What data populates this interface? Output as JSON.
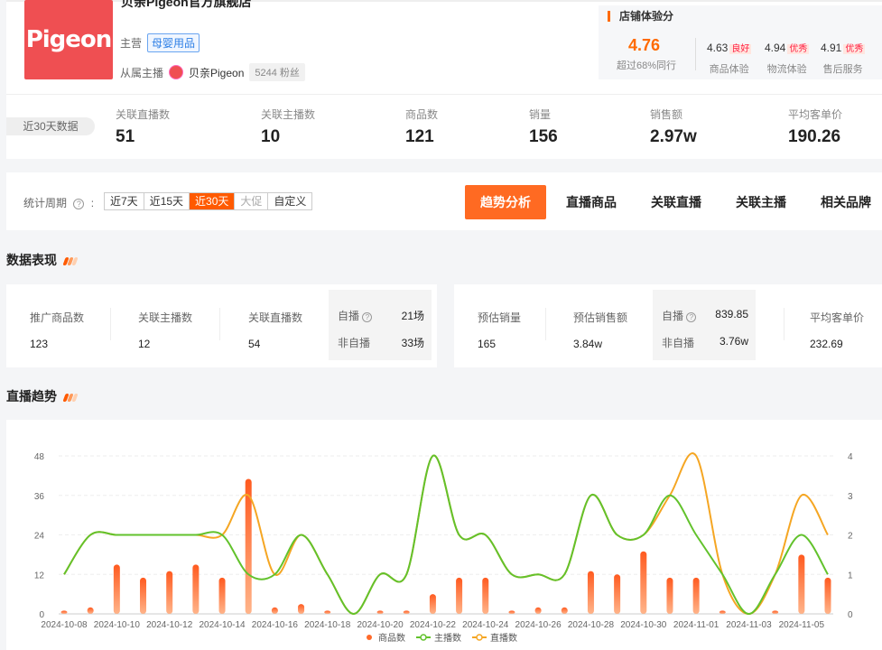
{
  "shop": {
    "logo_text": "Pigeon",
    "name": "贝亲Pigeon官方旗舰店",
    "main_label": "主营",
    "main_category": "母婴用品",
    "anchor_label": "从属主播",
    "anchor_name": "贝亲Pigeon",
    "fans": "5244 粉丝"
  },
  "score": {
    "title": "店铺体验分",
    "overall": "4.76",
    "beyond": "超过68%同行",
    "items": [
      {
        "value": "4.63",
        "badge": "良好",
        "label": "商品体验"
      },
      {
        "value": "4.94",
        "badge": "优秀",
        "label": "物流体验"
      },
      {
        "value": "4.91",
        "badge": "优秀",
        "label": "售后服务"
      }
    ]
  },
  "summary": {
    "period_label": "近30天数据",
    "stats": [
      {
        "label": "关联直播数",
        "value": "51"
      },
      {
        "label": "关联主播数",
        "value": "10"
      },
      {
        "label": "商品数",
        "value": "121"
      },
      {
        "label": "销量",
        "value": "156"
      },
      {
        "label": "销售额",
        "value": "2.97w"
      },
      {
        "label": "平均客单价",
        "value": "190.26"
      }
    ]
  },
  "toolbar": {
    "cycle_label": "统计周期",
    "help": "?",
    "colon": ":",
    "periods": [
      "近7天",
      "近15天",
      "近30天",
      "大促",
      "自定义"
    ],
    "active_period": 2,
    "tabs": [
      "趋势分析",
      "直播商品",
      "关联直播",
      "关联主播",
      "相关品牌"
    ],
    "active_tab": 0
  },
  "perf": {
    "title": "数据表现",
    "left": {
      "items": [
        {
          "label": "推广商品数",
          "value": "123"
        },
        {
          "label": "关联主播数",
          "value": "12"
        },
        {
          "label": "关联直播数",
          "value": "54"
        }
      ],
      "split": [
        {
          "label": "自播",
          "value": "21场"
        },
        {
          "label": "非自播",
          "value": "33场"
        }
      ]
    },
    "right": {
      "items": [
        {
          "label": "预估销量",
          "value": "165"
        },
        {
          "label": "预估销售额",
          "value": "3.84w"
        }
      ],
      "split": [
        {
          "label": "自播",
          "value": "839.85"
        },
        {
          "label": "非自播",
          "value": "3.76w"
        }
      ],
      "extra": {
        "label": "平均客单价",
        "value": "232.69"
      }
    }
  },
  "trend": {
    "title": "直播趋势"
  },
  "colors": {
    "accent": "#ff6a00",
    "bar": "#ff6a2a",
    "green": "#62c22c",
    "orange": "#f5a623"
  },
  "chart_data": {
    "type": "bar+line",
    "x": [
      "2024-10-08",
      "2024-10-09",
      "2024-10-10",
      "2024-10-11",
      "2024-10-12",
      "2024-10-13",
      "2024-10-14",
      "2024-10-15",
      "2024-10-16",
      "2024-10-17",
      "2024-10-18",
      "2024-10-19",
      "2024-10-20",
      "2024-10-21",
      "2024-10-22",
      "2024-10-23",
      "2024-10-24",
      "2024-10-25",
      "2024-10-26",
      "2024-10-27",
      "2024-10-28",
      "2024-10-29",
      "2024-10-30",
      "2024-10-31",
      "2024-11-01",
      "2024-11-02",
      "2024-11-03",
      "2024-11-04",
      "2024-11-05",
      "2024-11-06"
    ],
    "x_tick_labels": [
      "2024-10-08",
      "2024-10-10",
      "2024-10-12",
      "2024-10-14",
      "2024-10-16",
      "2024-10-18",
      "2024-10-20",
      "2024-10-22",
      "2024-10-24",
      "2024-10-26",
      "2024-10-28",
      "2024-10-30",
      "2024-11-01",
      "2024-11-03",
      "2024-11-05"
    ],
    "y_left": {
      "ticks": [
        "0",
        "12",
        "24",
        "36",
        "48"
      ],
      "range": [
        0,
        48
      ]
    },
    "y_right": {
      "ticks": [
        "0",
        "1",
        "2",
        "3",
        "4"
      ],
      "range": [
        0,
        4
      ]
    },
    "series": [
      {
        "name": "商品数",
        "type": "bar",
        "axis": "left",
        "values": [
          1,
          2,
          15,
          11,
          13,
          15,
          11,
          41,
          2,
          3,
          1,
          0,
          1,
          1,
          6,
          11,
          11,
          1,
          2,
          2,
          13,
          12,
          19,
          11,
          11,
          1,
          0,
          1,
          18,
          11
        ]
      },
      {
        "name": "主播数",
        "type": "line",
        "axis": "right",
        "values": [
          1,
          2,
          2,
          2,
          2,
          2,
          2,
          1,
          1,
          2,
          1,
          0,
          1,
          1,
          4,
          2,
          2,
          1,
          1,
          1,
          3,
          2,
          2,
          3,
          2,
          1,
          0,
          1,
          2,
          1
        ]
      },
      {
        "name": "直播数",
        "type": "line",
        "axis": "right",
        "values": [
          1,
          2,
          2,
          2,
          2,
          2,
          2,
          3,
          1,
          2,
          1,
          0,
          1,
          1,
          4,
          2,
          2,
          1,
          1,
          1,
          3,
          2,
          2,
          3,
          4,
          1,
          0,
          1,
          3,
          2
        ]
      }
    ],
    "legend": "bottom-center",
    "grid": true
  }
}
